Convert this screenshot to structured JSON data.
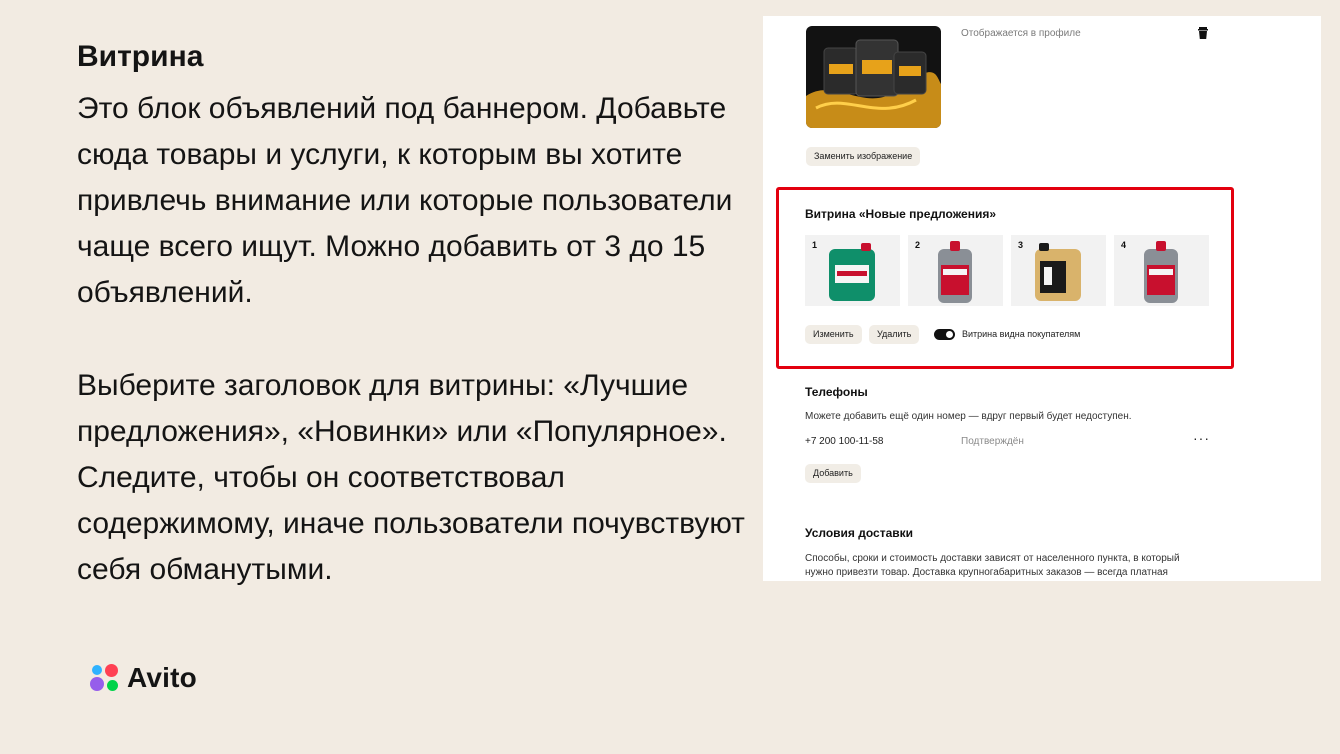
{
  "slide": {
    "title": "Витрина",
    "paragraph1": "Это блок объявлений под баннером. Добавьте сюда товары и услуги, к которым вы хотите привлечь внимание или которые пользователи чаще всего ищут. Можно добавить от 3 до 15 объявлений.",
    "paragraph2": "Выберите заголовок для витрины: «Лучшие предложения», «Новинки» или «Популярное». Следите, чтобы он соответствовал содержимому, иначе пользователи почувствуют себя обманутыми.",
    "logo_text": "Avito"
  },
  "banner": {
    "profile_note": "Отображается в профиле",
    "replace_button": "Заменить изображение",
    "delete_icon": "trash-icon"
  },
  "showcase": {
    "title": "Витрина «Новые предложения»",
    "items": [
      {
        "num": "1",
        "color": "#0f8f6a",
        "cap": "#c8102e"
      },
      {
        "num": "2",
        "color": "#8a8f96",
        "cap": "#c8102e"
      },
      {
        "num": "3",
        "color": "#d9b36b",
        "cap": "#1a1a1a"
      },
      {
        "num": "4",
        "color": "#8a8f96",
        "cap": "#c8102e"
      }
    ],
    "edit_button": "Изменить",
    "delete_button": "Удалить",
    "toggle_label": "Витрина видна покупателям",
    "toggle_on": true,
    "highlight_color": "#e3000f"
  },
  "phones": {
    "title": "Телефоны",
    "note": "Можете добавить ещё один номер — вдруг первый будет недоступен.",
    "number": "+7 200 100-11-58",
    "status": "Подтверждён",
    "more": "···",
    "add_button": "Добавить"
  },
  "delivery": {
    "title": "Условия доставки",
    "text": "Способы, сроки и стоимость доставки зависят от населенного пункта, в который нужно привезти товар. Доставка крупногабаритных заказов — всегда платная"
  }
}
